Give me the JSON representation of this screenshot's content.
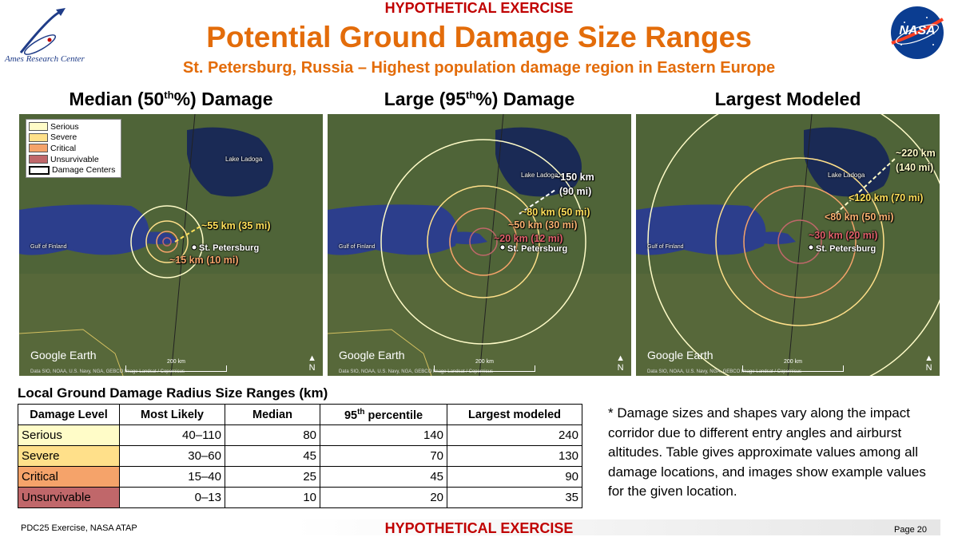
{
  "header": {
    "banner": "HYPOTHETICAL EXERCISE",
    "title": "Potential Ground Damage Size Ranges",
    "subtitle": "St. Petersburg, Russia – Highest population damage region in Eastern Europe",
    "left_logo_text": "Ames Research Center",
    "right_logo_text": "NASA"
  },
  "maps": [
    {
      "heading": "Median (50",
      "heading_sup": "th",
      "heading_tail": "%) Damage",
      "labels": [
        "~55 km (35 mi)",
        "~15 km (10 mi)"
      ]
    },
    {
      "heading": "Large (95",
      "heading_sup": "th",
      "heading_tail": "%) Damage",
      "labels": [
        "~150 km",
        "(90 mi)",
        "~80 km (50 mi)",
        "~50 km (30 mi)",
        "~20 km (12 mi)"
      ]
    },
    {
      "heading": "Largest Modeled",
      "heading_sup": "",
      "heading_tail": "",
      "labels": [
        "~220 km",
        "(140 mi)",
        "<120 km (70 mi)",
        "<80 km (50 mi)",
        "~30 km (20 mi)"
      ]
    }
  ],
  "map_common": {
    "city": "St. Petersburg",
    "lake": "Lake Ladoga",
    "gulf": "Gulf of Finland",
    "brand": "Google Earth",
    "credit": "Data SIO, NOAA, U.S. Navy, NGA, GEBCO  Image Landsat / Copernicus",
    "scale": "200 km",
    "north": "N"
  },
  "legend": [
    {
      "label": "Serious",
      "color": "#fffcc8"
    },
    {
      "label": "Severe",
      "color": "#ffe08a"
    },
    {
      "label": "Critical",
      "color": "#f5a36a"
    },
    {
      "label": "Unsurvivable",
      "color": "#c0676a"
    },
    {
      "label": "Damage Centers",
      "color": "#ffffff"
    }
  ],
  "table": {
    "title": "Local Ground Damage Radius Size Ranges (km)",
    "headers": [
      "Damage Level",
      "Most Likely",
      "Median",
      "95",
      "Largest modeled"
    ],
    "header_sup": "th",
    "header_tail": " percentile",
    "rows": [
      {
        "level": "Serious",
        "color": "#fffcc8",
        "most_likely": "40–110",
        "median": "80",
        "p95": "140",
        "largest": "240"
      },
      {
        "level": "Severe",
        "color": "#ffe08a",
        "most_likely": "30–60",
        "median": "45",
        "p95": "70",
        "largest": "130"
      },
      {
        "level": "Critical",
        "color": "#f5a36a",
        "most_likely": "15–40",
        "median": "25",
        "p95": "45",
        "largest": "90"
      },
      {
        "level": "Unsurvivable",
        "color": "#c0676a",
        "most_likely": "0–13",
        "median": "10",
        "p95": "20",
        "largest": "35"
      }
    ]
  },
  "note": "* Damage sizes and shapes vary along the impact corridor due to different entry angles and airburst altitudes. Table gives approximate values among all damage locations, and images show example values for the given location.",
  "footer": {
    "left": "PDC25 Exercise, NASA ATAP",
    "center": "HYPOTHETICAL EXERCISE",
    "right": "Page 20"
  }
}
